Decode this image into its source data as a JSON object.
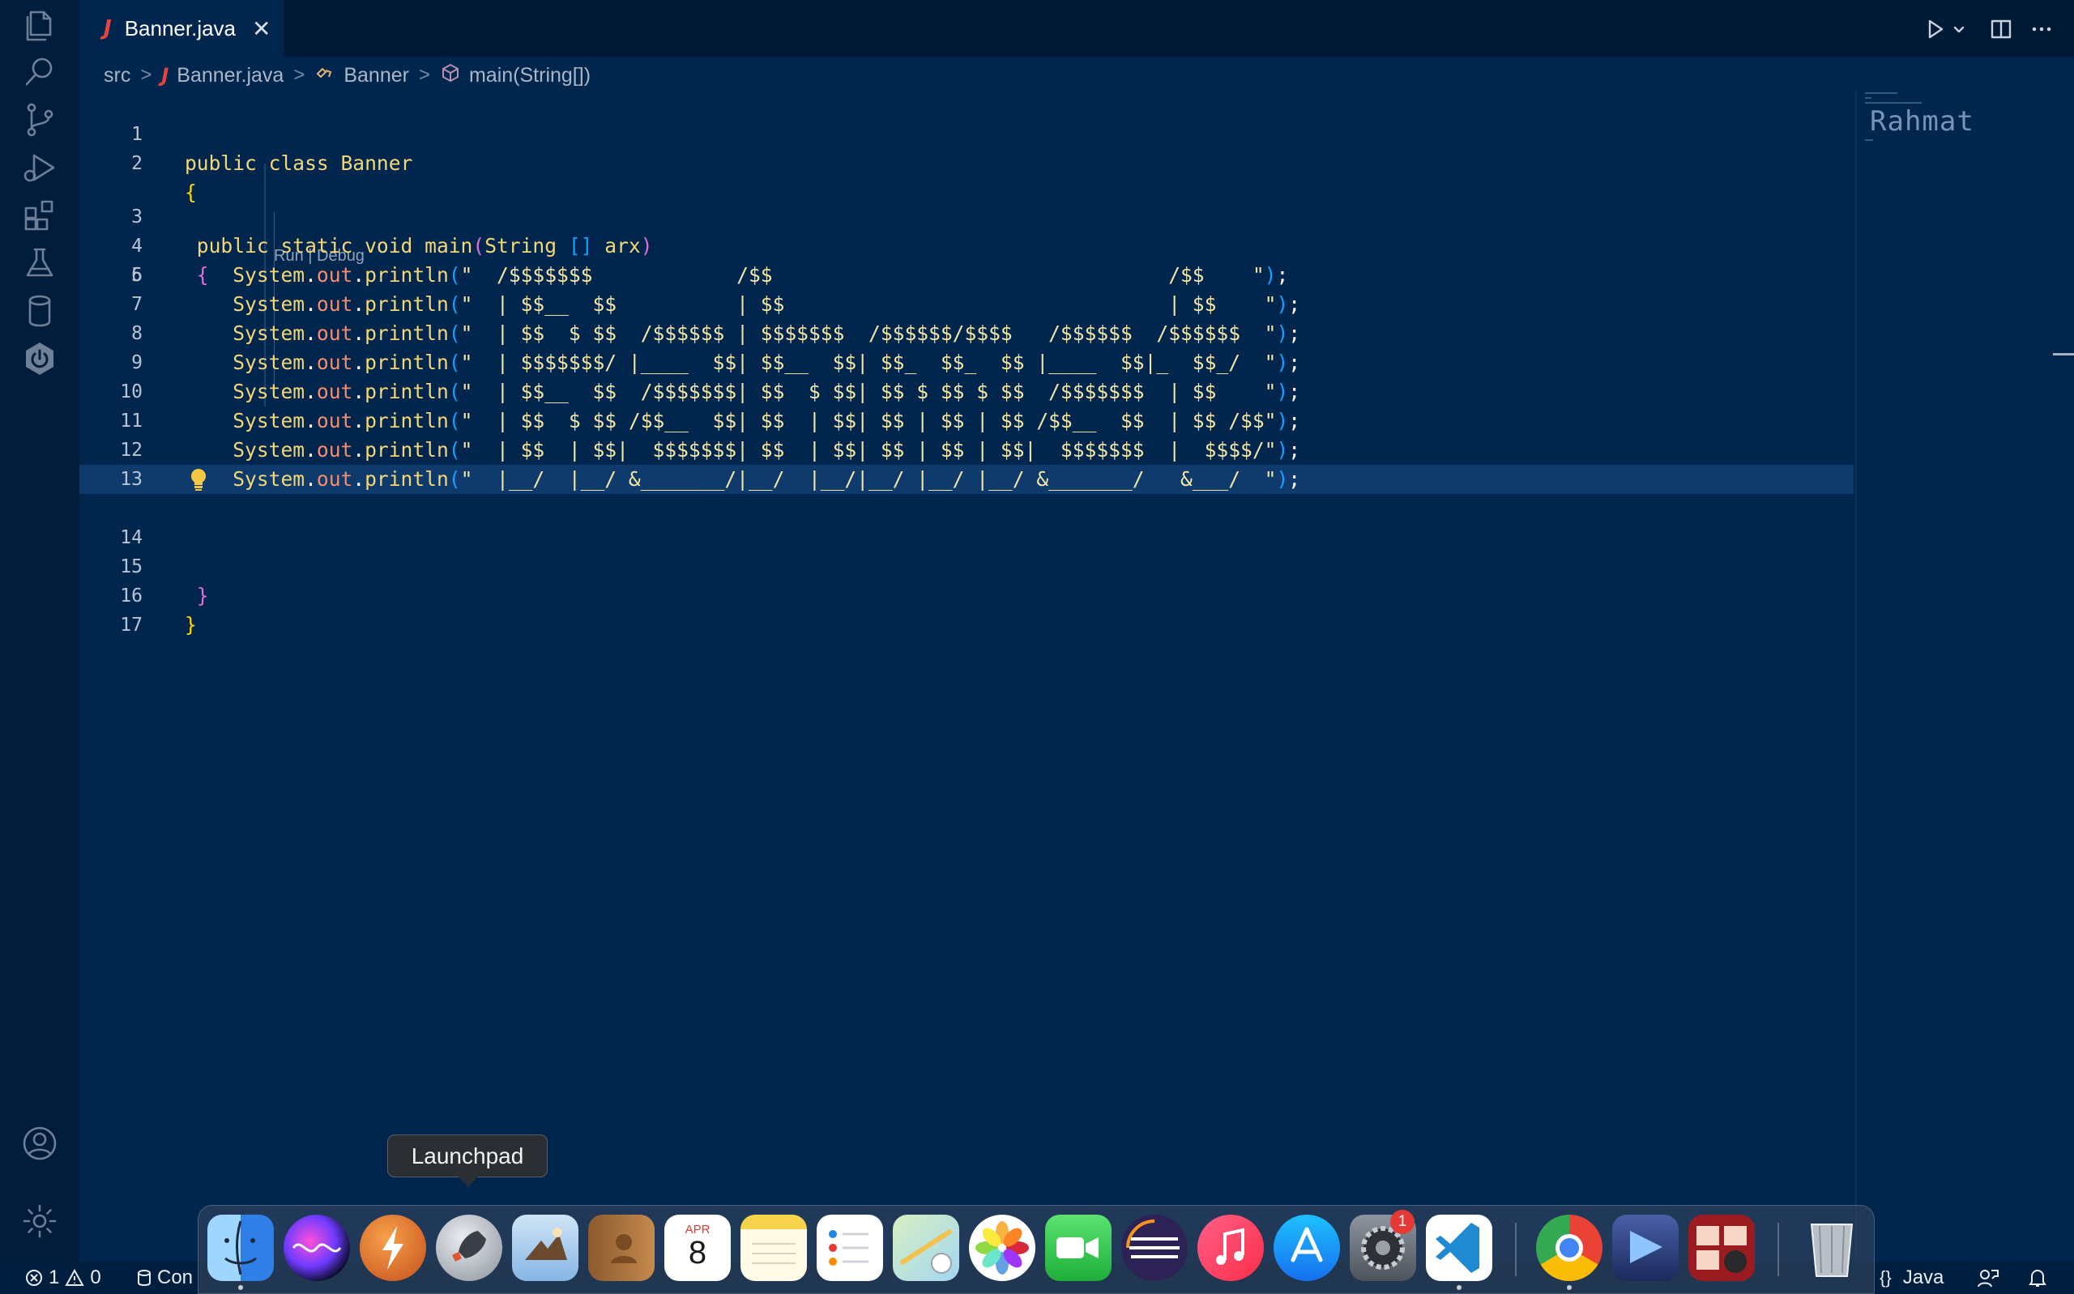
{
  "tab": {
    "icon_letter": "J",
    "label": "Banner.java",
    "close": "✕"
  },
  "breadcrumb": {
    "src": "src",
    "sep": ">",
    "file_icon": "J",
    "file": "Banner.java",
    "class": "Banner",
    "method": "main(String[])"
  },
  "codelens": "Run | Debug",
  "lines": [
    {
      "n": "1",
      "code": "public class Banner"
    },
    {
      "n": "2",
      "code": "{"
    },
    {
      "n": "3",
      "code": " public static void main(String [] arx)"
    },
    {
      "n": "4",
      "code": " {"
    },
    {
      "n": "5",
      "code": ""
    },
    {
      "n": "6",
      "code": "    System.out.println(\"  /$$$$$$$            /$$                                 /$$    \");"
    },
    {
      "n": "7",
      "code": "    System.out.println(\"  | $$__  $$          | $$                                | $$    \");"
    },
    {
      "n": "8",
      "code": "    System.out.println(\"  | $$  $ $$  /$$$$$$ | $$$$$$$  /$$$$$$/$$$$   /$$$$$$  /$$$$$$  \");"
    },
    {
      "n": "9",
      "code": "    System.out.println(\"  | $$$$$$$/ |____  $$| $$__  $$| $$_  $$_  $$ |____  $$|_  $$_/  \");"
    },
    {
      "n": "10",
      "code": "    System.out.println(\"  | $$__  $$  /$$$$$$$| $$  $ $$| $$ $ $$ $ $$  /$$$$$$$  | $$    \");"
    },
    {
      "n": "11",
      "code": "    System.out.println(\"  | $$  $ $$ /$$__  $$| $$  | $$| $$ | $$ | $$ /$$__  $$  | $$ /$$\");"
    },
    {
      "n": "12",
      "code": "    System.out.println(\"  | $$  | $$|  $$$$$$$| $$  | $$| $$ | $$ | $$|  $$$$$$$  |  $$$$/\");"
    },
    {
      "n": "13",
      "code": "    System.out.println(\"  |__/  |__/ &_______/|__/  |__/|__/ |__/ |__/ &_______/   &___/  \");"
    },
    {
      "n": "14",
      "code": ""
    },
    {
      "n": "15",
      "code": " }"
    },
    {
      "n": "16",
      "code": "}"
    },
    {
      "n": "17",
      "code": ""
    }
  ],
  "minimap_text": "Rahmat",
  "status": {
    "errors": "1",
    "warnings": "0",
    "con": "Con",
    "language": "Java",
    "braces": "{}"
  },
  "dock": {
    "tooltip": "Launchpad",
    "calendar_month": "APR",
    "calendar_day": "8",
    "settings_badge": "1",
    "apps": [
      "finder-icon",
      "siri-icon",
      "reeder-icon",
      "launchpad-icon",
      "preview-icon",
      "contacts-icon",
      "calendar-icon",
      "notes-icon",
      "reminders-icon",
      "maps-icon",
      "photos-icon",
      "facetime-icon",
      "eclipse-icon",
      "music-icon",
      "app-store-icon",
      "system-preferences-icon",
      "vscode-icon",
      "chrome-icon",
      "keynote-icon",
      "photo-booth-icon",
      "trash-icon"
    ]
  },
  "colors": {
    "editor_bg": "#01264e",
    "activity_bg": "#021d3c",
    "keyword": "#f3d776",
    "string": "#f2e6a5",
    "field": "#f78c6c",
    "current_line": "#0e3a6c"
  }
}
